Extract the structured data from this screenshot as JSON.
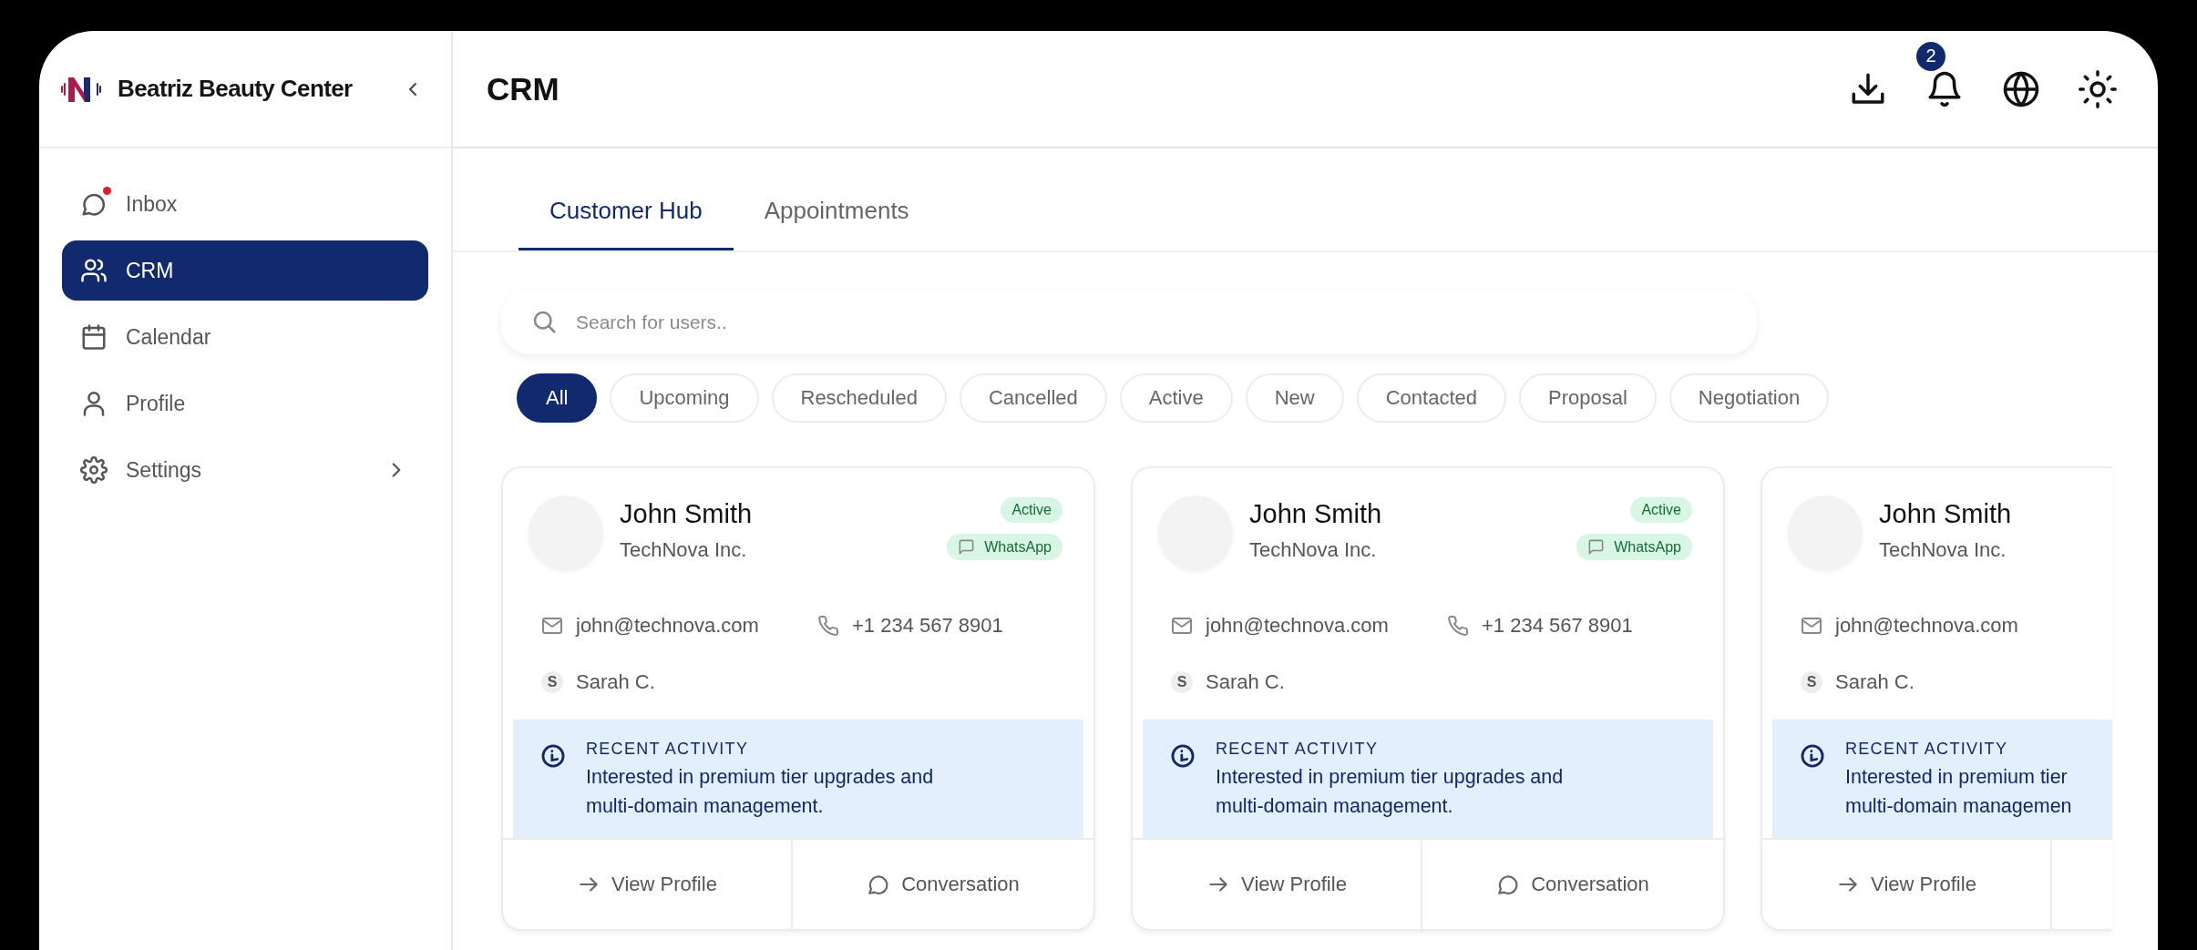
{
  "sidebar": {
    "brand": "Beatriz Beauty Center",
    "items": [
      {
        "label": "Inbox",
        "kind": "chat",
        "selected": false,
        "unread": true,
        "expandable": false
      },
      {
        "label": "CRM",
        "kind": "people",
        "selected": true,
        "unread": false,
        "expandable": false
      },
      {
        "label": "Calendar",
        "kind": "calendar",
        "selected": false,
        "unread": false,
        "expandable": false
      },
      {
        "label": "Profile",
        "kind": "person",
        "selected": false,
        "unread": false,
        "expandable": false
      },
      {
        "label": "Settings",
        "kind": "gear",
        "selected": false,
        "unread": false,
        "expandable": true
      }
    ]
  },
  "header": {
    "title": "CRM",
    "notifications": "2"
  },
  "tabs": [
    {
      "label": "Customer Hub",
      "selected": true
    },
    {
      "label": "Appointments",
      "selected": false
    }
  ],
  "search": {
    "placeholder": "Search for users.."
  },
  "filters": [
    {
      "label": "All",
      "selected": true
    },
    {
      "label": "Upcoming",
      "selected": false
    },
    {
      "label": "Rescheduled",
      "selected": false
    },
    {
      "label": "Cancelled",
      "selected": false
    },
    {
      "label": "Active",
      "selected": false
    },
    {
      "label": "New",
      "selected": false
    },
    {
      "label": "Contacted",
      "selected": false
    },
    {
      "label": "Proposal",
      "selected": false
    },
    {
      "label": "Negotiation",
      "selected": false
    }
  ],
  "cards": [
    {
      "name": "John Smith",
      "company": "TechNova Inc.",
      "status": "Active",
      "channel": "WhatsApp",
      "email": "john@technova.com",
      "phone": "+1 234 567 8901",
      "owner_initial": "S",
      "owner": "Sarah C.",
      "activity_label": "RECENT ACTIVITY",
      "activity_lines": [
        "Interested in premium tier upgrades and",
        "multi-domain management."
      ],
      "actions": [
        "View Profile",
        "Conversation"
      ],
      "cut": false
    },
    {
      "name": "John Smith",
      "company": "TechNova Inc.",
      "status": "Active",
      "channel": "WhatsApp",
      "email": "john@technova.com",
      "phone": "+1 234 567 8901",
      "owner_initial": "S",
      "owner": "Sarah C.",
      "activity_label": "RECENT ACTIVITY",
      "activity_lines": [
        "Interested in premium tier upgrades and",
        "multi-domain management."
      ],
      "actions": [
        "View Profile",
        "Conversation"
      ],
      "cut": false
    },
    {
      "name": "John Smith",
      "company": "TechNova Inc.",
      "email": "john@technova.com",
      "owner_initial": "S",
      "owner": "Sarah C.",
      "activity_label": "RECENT ACTIVITY",
      "activity_lines": [
        "Interested in premium tier",
        "multi-domain managemen"
      ],
      "actions": [
        "View Profile"
      ],
      "cut": true
    }
  ]
}
